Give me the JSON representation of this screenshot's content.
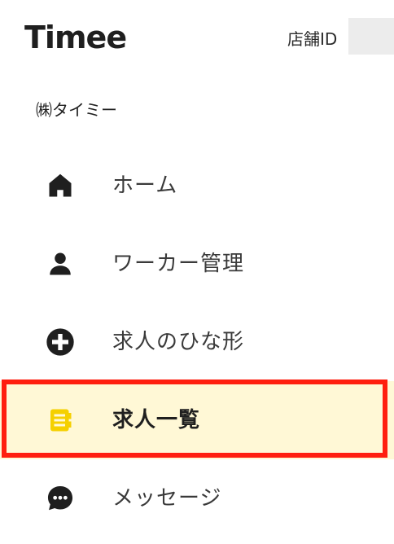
{
  "header": {
    "logo_text": "Timee",
    "store_id_label": "店舗ID",
    "store_id_value": ""
  },
  "company_name": "㈱タイミー",
  "nav": {
    "items": [
      {
        "label": "ホーム",
        "icon": "home-icon",
        "active": false
      },
      {
        "label": "ワーカー管理",
        "icon": "person-icon",
        "active": false
      },
      {
        "label": "求人のひな形",
        "icon": "plus-circle-icon",
        "active": false
      },
      {
        "label": "求人一覧",
        "icon": "document-list-icon",
        "active": true
      },
      {
        "label": "メッセージ",
        "icon": "chat-bubble-icon",
        "active": false
      }
    ]
  },
  "colors": {
    "accent": "#f5d000",
    "active_bg": "#fff8d6",
    "highlight_border": "#ff1f0f",
    "icon": "#1f1f1f"
  }
}
